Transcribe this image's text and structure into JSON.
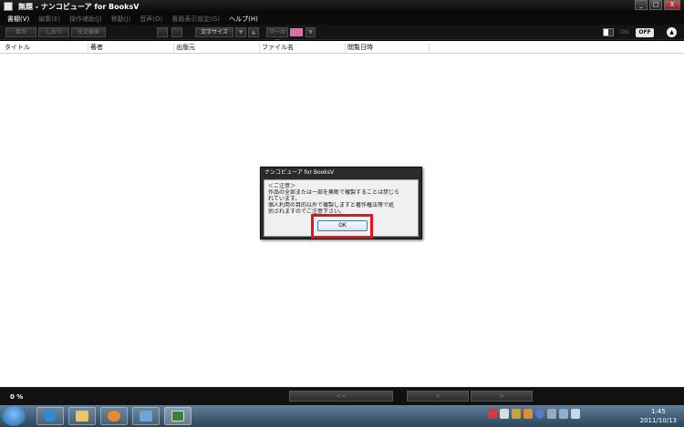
{
  "window": {
    "title": "無題 - ナンコビューア for BooksV",
    "buttons": [
      "_",
      "□",
      "X"
    ]
  },
  "menu": {
    "items": [
      {
        "label": "書棚(V)",
        "active": true
      },
      {
        "label": "編集(E)",
        "active": false
      },
      {
        "label": "操作補助(J)",
        "active": false
      },
      {
        "label": "移動(J)",
        "active": false
      },
      {
        "label": "音声(O)",
        "active": false
      },
      {
        "label": "書籍表示設定(G)",
        "active": false
      },
      {
        "label": "ヘルプ(H)",
        "active": true
      }
    ]
  },
  "toolbar": {
    "toc": "目次",
    "bookmark": "しおり",
    "fulltext_search": "全文検索",
    "font_size": "文字サイズ",
    "font_down": "▼",
    "font_up": "▲",
    "marker": "マーカー",
    "marker_dropdown": "▼",
    "on_label": "ON",
    "off_label": "OFF",
    "up_arrow": "▲",
    "marker_color": "#e26ba4"
  },
  "list": {
    "columns": [
      "タイトル",
      "著者",
      "出版元",
      "ファイル名",
      "閲覧日時"
    ]
  },
  "dialog": {
    "title": "ナンコビューア for BooksV",
    "lines": [
      "＜ご注意＞",
      "作品の全部または一部を無断で複製することは禁じら",
      "れています。",
      "個人利用の目的以外で複製しますと著作権法等で処",
      "罰されますのでご注意下さい。"
    ],
    "ok_label": "OK"
  },
  "status": {
    "zoom": "0 %",
    "first": "<<",
    "prev": "<",
    "next": ">",
    "last": ">>"
  },
  "taskbar": {
    "time": "1:45",
    "date": "2011/10/13"
  }
}
